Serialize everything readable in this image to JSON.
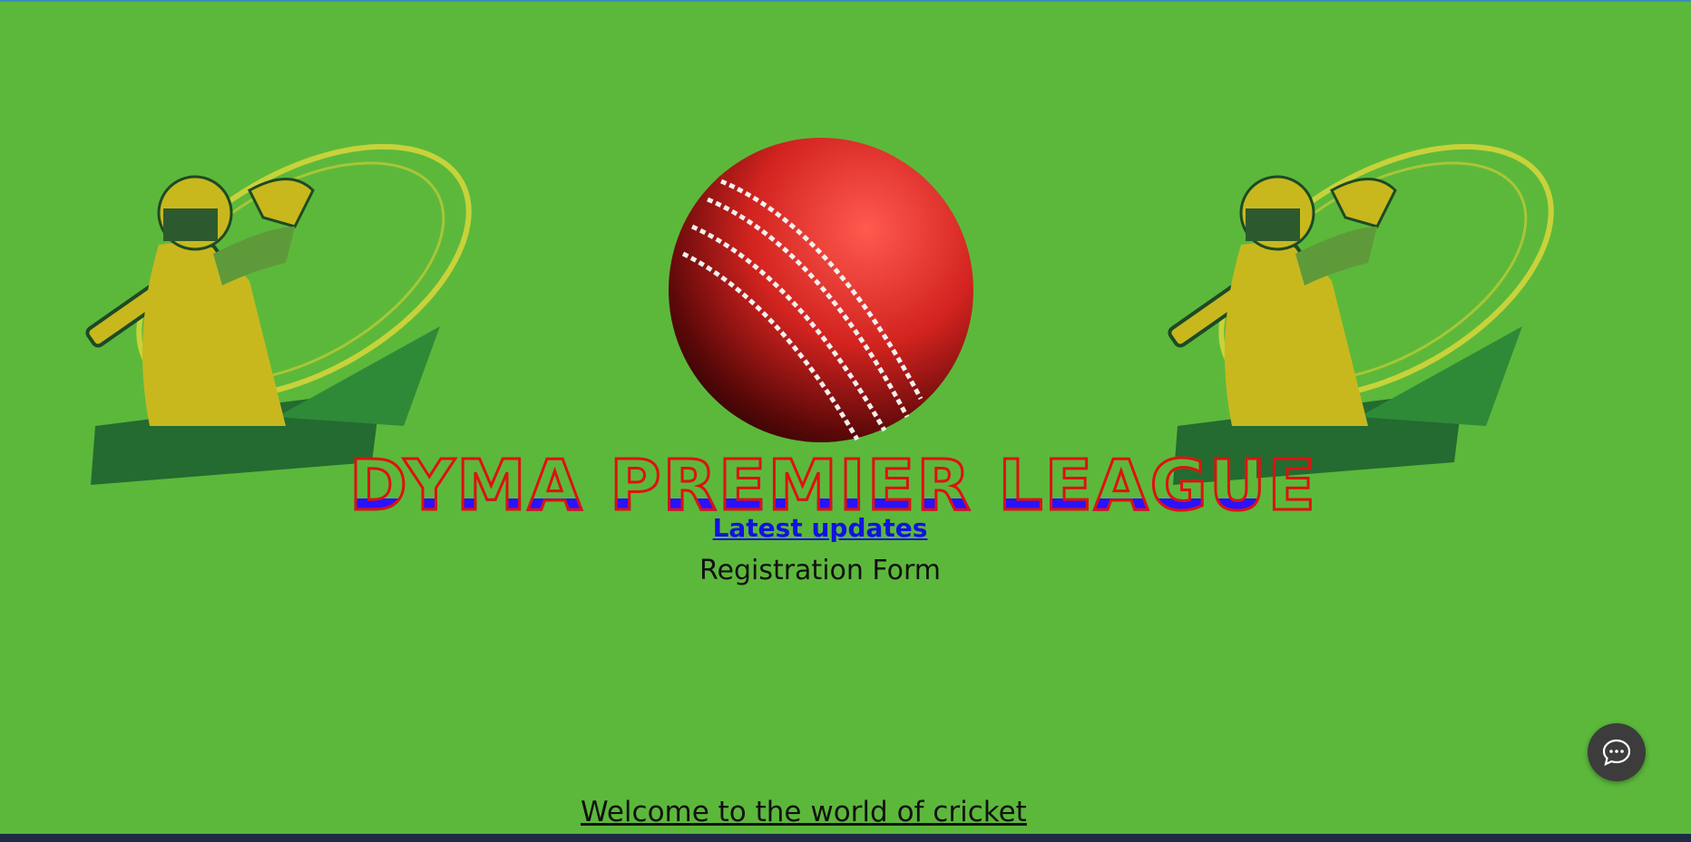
{
  "page": {
    "title": "DYMA PREMIER LEAGUE",
    "latest_updates_link": "Latest updates",
    "registration_text": "Registration Form",
    "welcome_text": "Welcome to the world of cricket"
  },
  "images": {
    "left_player": "cricket-batsman-illustration",
    "center_ball": "red-cricket-ball",
    "right_player": "cricket-batsman-illustration"
  },
  "chat": {
    "icon": "chat-bubble-icon"
  },
  "colors": {
    "background": "#5cb83b",
    "title_fill": "#2a12ff",
    "title_outline": "#e01010",
    "link": "#1212e0"
  }
}
